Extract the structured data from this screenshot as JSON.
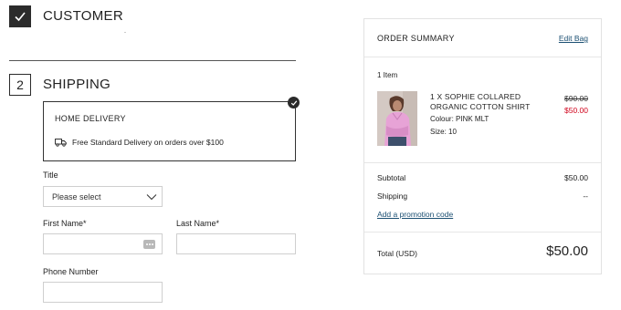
{
  "steps": {
    "customer": {
      "title": "CUSTOMER",
      "icon": "checkmark-icon"
    },
    "shipping": {
      "number": "2",
      "title": "SHIPPING"
    }
  },
  "delivery": {
    "title": "HOME DELIVERY",
    "description": "Free Standard Delivery on orders over $100",
    "icon": "truck-icon",
    "selected": true
  },
  "form": {
    "title_label": "Title",
    "title_value": "Please select",
    "first_name_label": "First Name*",
    "last_name_label": "Last Name*",
    "phone_label": "Phone Number",
    "first_name_value": "",
    "last_name_value": "",
    "phone_value": ""
  },
  "summary": {
    "title": "ORDER SUMMARY",
    "edit_label": "Edit Bag",
    "item_count": "1 Item",
    "product": {
      "name": "1 X SOPHIE COLLARED ORGANIC COTTON SHIRT",
      "colour": "Colour: PINK MLT",
      "size": "Size: 10",
      "original_price": "$90.00",
      "sale_price": "$50.00"
    },
    "subtotal_label": "Subtotal",
    "subtotal_value": "$50.00",
    "shipping_label": "Shipping",
    "shipping_value": "--",
    "promo_label": "Add a promotion code",
    "total_label": "Total (USD)",
    "total_value": "$50.00"
  },
  "colors": {
    "dark": "#2b2b2b",
    "link": "#1b4f72",
    "sale": "#d0021b",
    "border": "#cfcfcf"
  }
}
